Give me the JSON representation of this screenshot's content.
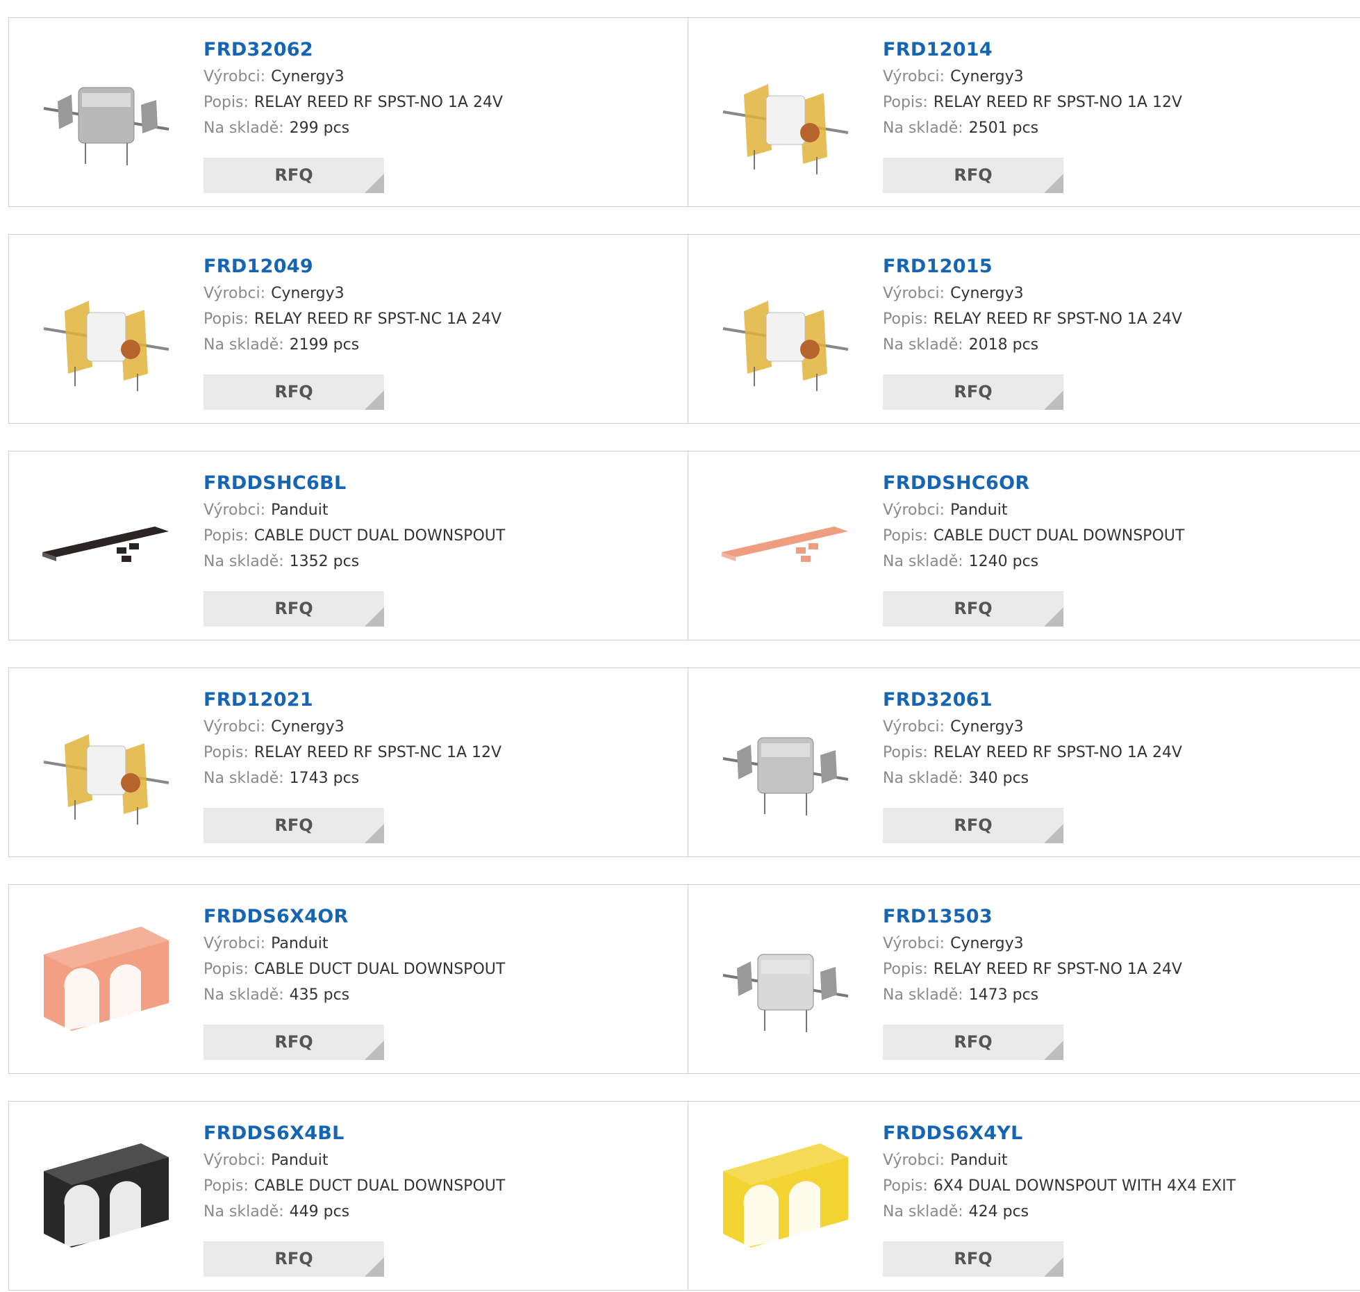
{
  "labels": {
    "manufacturer": "Výrobci:",
    "description": "Popis:",
    "stock": "Na skladě:",
    "rfq": "RFQ"
  },
  "products": [
    {
      "pn": "FRD32062",
      "manufacturer": "Cynergy3",
      "description": "RELAY REED RF SPST-NO 1A 24V",
      "stock": "299 pcs",
      "image": "relay-metal-icon",
      "color": "#b9b9b9"
    },
    {
      "pn": "FRD12014",
      "manufacturer": "Cynergy3",
      "description": "RELAY REED RF SPST-NO 1A 12V",
      "stock": "2501 pcs",
      "image": "relay-reed-icon",
      "color": "#e0b33a"
    },
    {
      "pn": "FRD12049",
      "manufacturer": "Cynergy3",
      "description": "RELAY REED RF SPST-NC 1A 24V",
      "stock": "2199 pcs",
      "image": "relay-reed-icon",
      "color": "#e0b33a"
    },
    {
      "pn": "FRD12015",
      "manufacturer": "Cynergy3",
      "description": "RELAY REED RF SPST-NO 1A 24V",
      "stock": "2018 pcs",
      "image": "relay-reed-icon",
      "color": "#e0b33a"
    },
    {
      "pn": "FRDDSHC6BL",
      "manufacturer": "Panduit",
      "description": "CABLE DUCT DUAL DOWNSPOUT",
      "stock": "1352 pcs",
      "image": "duct-cover-icon",
      "color": "#2a2424"
    },
    {
      "pn": "FRDDSHC6OR",
      "manufacturer": "Panduit",
      "description": "CABLE DUCT DUAL DOWNSPOUT",
      "stock": "1240 pcs",
      "image": "duct-cover-icon",
      "color": "#ef9d80"
    },
    {
      "pn": "FRD12021",
      "manufacturer": "Cynergy3",
      "description": "RELAY REED RF SPST-NC 1A 12V",
      "stock": "1743 pcs",
      "image": "relay-reed-icon",
      "color": "#e0b33a"
    },
    {
      "pn": "FRD32061",
      "manufacturer": "Cynergy3",
      "description": "RELAY REED RF SPST-NO 1A 24V",
      "stock": "340 pcs",
      "image": "relay-metal-icon",
      "color": "#c4c4c4"
    },
    {
      "pn": "FRDDS6X4OR",
      "manufacturer": "Panduit",
      "description": "CABLE DUCT DUAL DOWNSPOUT",
      "stock": "435 pcs",
      "image": "duct-downspout-icon",
      "color": "#f29a7c"
    },
    {
      "pn": "FRD13503",
      "manufacturer": "Cynergy3",
      "description": "RELAY REED RF SPST-NO 1A 24V",
      "stock": "1473 pcs",
      "image": "relay-metal-icon",
      "color": "#d9d9d9"
    },
    {
      "pn": "FRDDS6X4BL",
      "manufacturer": "Panduit",
      "description": "CABLE DUCT DUAL DOWNSPOUT",
      "stock": "449 pcs",
      "image": "duct-downspout-icon",
      "color": "#1c1c1c"
    },
    {
      "pn": "FRDDS6X4YL",
      "manufacturer": "Panduit",
      "description": "6X4 DUAL DOWNSPOUT WITH 4X4 EXIT",
      "stock": "424 pcs",
      "image": "duct-downspout-icon",
      "color": "#f2d227"
    }
  ]
}
